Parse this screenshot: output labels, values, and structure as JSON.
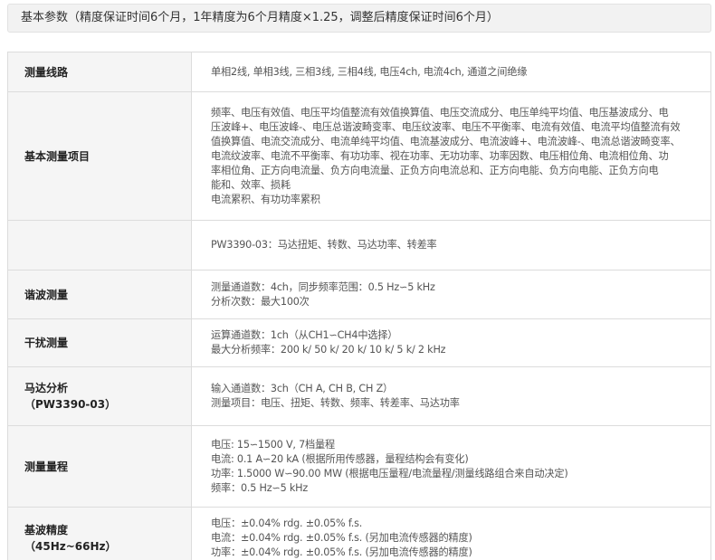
{
  "header": {
    "title": "基本参数（精度保证时间6个月，1年精度为6个月精度×1.25，调整后精度保证时间6个月）"
  },
  "rows": [
    {
      "label": "测量线路",
      "lines": [
        "单相2线, 单相3线, 三相3线, 三相4线, 电压4ch, 电流4ch, 通道之间绝缘"
      ]
    },
    {
      "label": "基本测量项目",
      "lines": [
        "频率、电压有效值、电压平均值整流有效值换算值、电压交流成分、电压单纯平均值、电压基波成分、电",
        "压波峰+、电压波峰-、电压总谐波畸变率、电压纹波率、电压不平衡率、电流有效值、电流平均值整流有效",
        "值换算值、电流交流成分、电流单纯平均值、电流基波成分、电流波峰+、电流波峰-、电流总谐波畸变率、",
        "电流纹波率、电流不平衡率、有功功率、视在功率、无功功率、功率因数、电压相位角、电流相位角、功",
        "率相位角、正方向电流量、负方向电流量、正负方向电流总和、正方向电能、负方向电能、正负方向电",
        "能和、效率、损耗",
        "电流累积、有功功率累积"
      ]
    },
    {
      "label": "",
      "lines": [
        "PW3390-03：马达扭矩、转数、马达功率、转差率"
      ]
    },
    {
      "label": "谐波测量",
      "lines": [
        "测量通道数：4ch，同步频率范围：0.5 Hz∽5 kHz",
        "分析次数：最大100次"
      ]
    },
    {
      "label": "干扰测量",
      "lines": [
        "运算通道数：1ch（从CH1∽CH4中选择）",
        "最大分析频率：200 k/ 50 k/ 20 k/ 10 k/ 5 k/ 2 kHz"
      ]
    },
    {
      "label": "马达分析",
      "label2": "（PW3390-03）",
      "lines": [
        "输入通道数：3ch（CH A, CH B, CH Z）",
        "测量项目：电压、扭矩、转数、频率、转差率、马达功率"
      ]
    },
    {
      "label": "测量量程",
      "lines": [
        "电压: 15∽1500 V, 7档量程",
        "电流: 0.1 A∽20 kA (根据所用传感器，量程结构会有变化)",
        "功率: 1.5000 W∽90.00 MW (根据电压量程/电流量程/测量线路组合来自动决定)",
        "频率：0.5 Hz∽5 kHz"
      ]
    },
    {
      "label": "基波精度",
      "label2": "（45Hz~66Hz）",
      "lines": [
        "电压：±0.04% rdg. ±0.05% f.s.",
        "电流：±0.04% rdg. ±0.05% f.s. (另加电流传感器的精度)",
        "功率：±0.04% rdg. ±0.05% f.s. (另加电流传感器的精度)"
      ]
    }
  ]
}
